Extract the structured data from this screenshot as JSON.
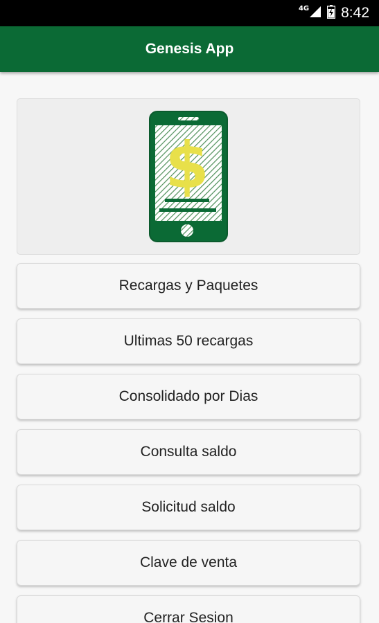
{
  "status_bar": {
    "network_type": "4G",
    "time": "8:42",
    "icons": [
      "signal-icon",
      "battery-icon"
    ]
  },
  "app_bar": {
    "title": "Genesis App"
  },
  "colors": {
    "primary": "#0b6a35",
    "accent_dollar": "#e8e04a"
  },
  "banner": {
    "icon": "phone-dollar-icon"
  },
  "menu": {
    "items": [
      {
        "label": "Recargas y Paquetes"
      },
      {
        "label": "Ultimas 50 recargas"
      },
      {
        "label": "Consolidado por Dias"
      },
      {
        "label": "Consulta saldo"
      },
      {
        "label": "Solicitud saldo"
      },
      {
        "label": "Clave de venta"
      },
      {
        "label": "Cerrar Sesion"
      }
    ]
  }
}
